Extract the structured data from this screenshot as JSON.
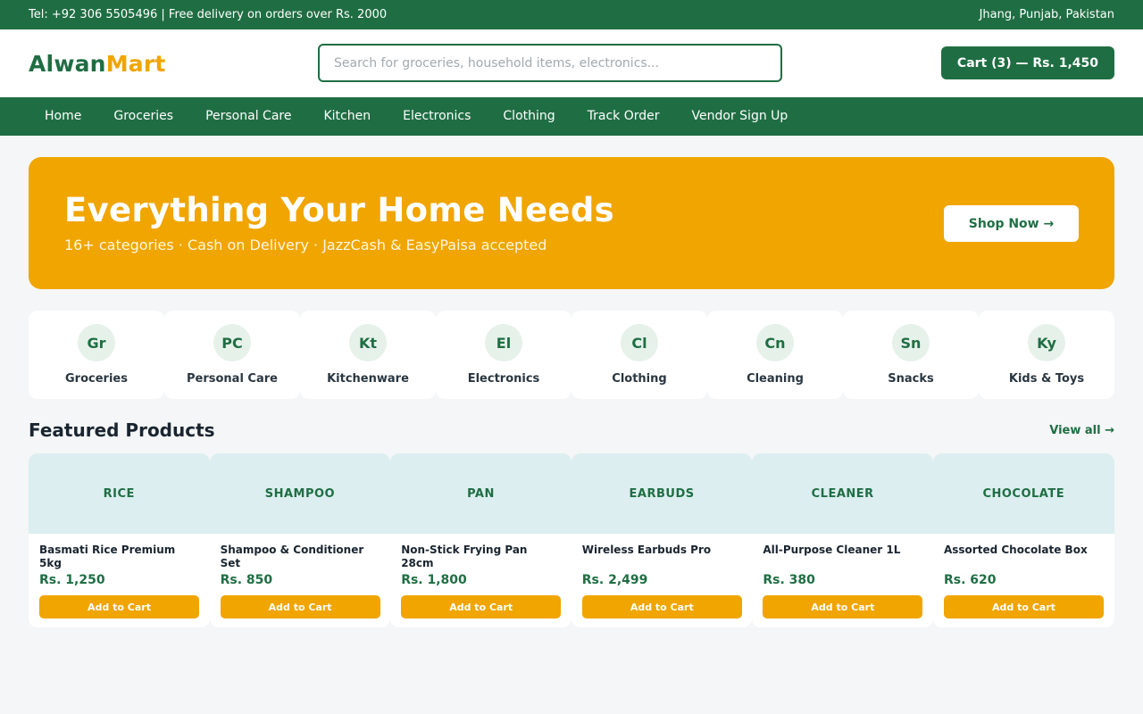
{
  "topbar": {
    "contact": "Tel: +92 306 5505496 | Free delivery on orders over Rs. 2000",
    "location": "Jhang, Punjab, Pakistan"
  },
  "header": {
    "logo_part1": "Alwan",
    "logo_part2": "Mart",
    "search_placeholder": "Search for groceries, household items, electronics...",
    "search_value": "",
    "cart_label": "Cart (3) — Rs. 1,450"
  },
  "nav": {
    "items": [
      "Home",
      "Groceries",
      "Personal Care",
      "Kitchen",
      "Electronics",
      "Clothing",
      "Track Order",
      "Vendor Sign Up"
    ]
  },
  "hero": {
    "title": "Everything Your Home Needs",
    "subtitle": "16+ categories · Cash on Delivery · JazzCash & EasyPaisa accepted",
    "cta": "Shop Now →"
  },
  "categories": [
    {
      "abbr": "Gr",
      "label": "Groceries"
    },
    {
      "abbr": "PC",
      "label": "Personal Care"
    },
    {
      "abbr": "Kt",
      "label": "Kitchenware"
    },
    {
      "abbr": "El",
      "label": "Electronics"
    },
    {
      "abbr": "Cl",
      "label": "Clothing"
    },
    {
      "abbr": "Cn",
      "label": "Cleaning"
    },
    {
      "abbr": "Sn",
      "label": "Snacks"
    },
    {
      "abbr": "Ky",
      "label": "Kids & Toys"
    }
  ],
  "featured": {
    "title": "Featured Products",
    "view_all": "View all →",
    "add_label": "Add to Cart",
    "products": [
      {
        "thumb": "RICE",
        "name": "Basmati Rice Premium 5kg",
        "price": "Rs. 1,250"
      },
      {
        "thumb": "SHAMPOO",
        "name": "Shampoo & Conditioner Set",
        "price": "Rs. 850"
      },
      {
        "thumb": "PAN",
        "name": "Non-Stick Frying Pan 28cm",
        "price": "Rs. 1,800"
      },
      {
        "thumb": "EARBUDS",
        "name": "Wireless Earbuds Pro",
        "price": "Rs. 2,499"
      },
      {
        "thumb": "CLEANER",
        "name": "All-Purpose Cleaner 1L",
        "price": "Rs. 380"
      },
      {
        "thumb": "CHOCOLATE",
        "name": "Assorted Chocolate Box",
        "price": "Rs. 620"
      }
    ]
  },
  "colors": {
    "brand_green": "#1f6e43",
    "accent_orange": "#f0a500",
    "thumb_bg": "#dceef0",
    "page_bg": "#f4f6f7"
  }
}
